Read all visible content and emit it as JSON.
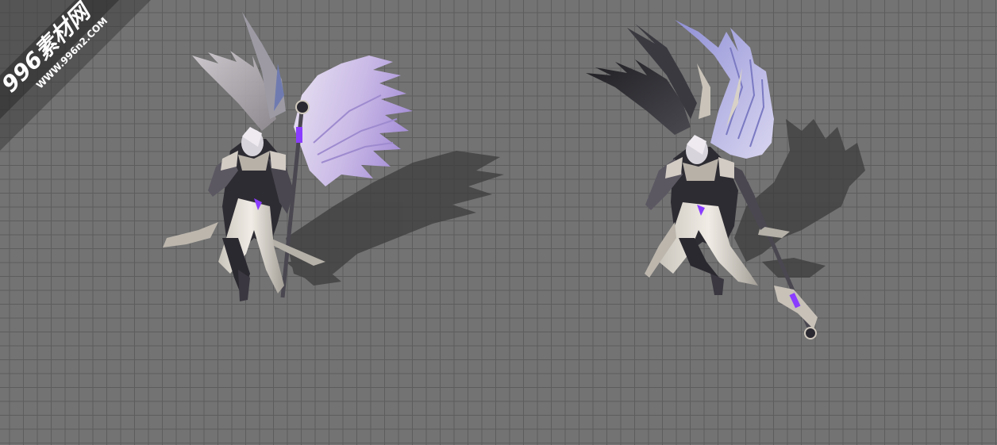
{
  "watermark": {
    "brand": "996素材网",
    "url": "WWW.996n2.COM"
  },
  "scene": {
    "background": "#737373",
    "grid_line_color": "#5d5d5d",
    "characters": [
      {
        "name": "winged-reaper",
        "pose": "idle",
        "wing_colors": [
          "#cfc4dc",
          "#b9a6e0"
        ],
        "gem_color": "#8a3dff"
      },
      {
        "name": "winged-reaper",
        "pose": "walk",
        "wing_colors": [
          "#2b2a2e",
          "#b7b6e6"
        ],
        "gem_color": "#8a3dff"
      }
    ]
  }
}
